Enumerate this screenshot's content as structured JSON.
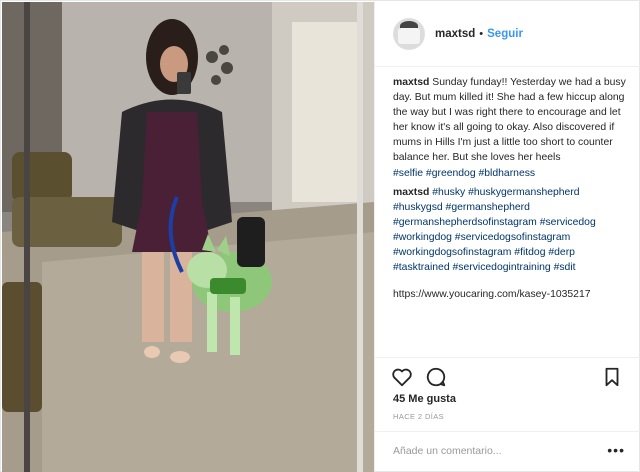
{
  "post": {
    "username": "maxtsd",
    "follow_label": "Seguir",
    "separator": "•",
    "caption": {
      "username": "maxtsd",
      "text": "Sunday funday!! Yesterday we had a busy day. But mum killed it! She had a few hiccup along the way but I was right there to encourage and let her know it's all going to okay. Also discovered if mums in Hills I'm just a little too short to counter balance her. But she loves her heels",
      "tags": "#selfie #greendog #bldharness"
    },
    "comment": {
      "username": "maxtsd",
      "tags": "#husky #huskygermanshepherd #huskygsd #germanshepherd #germanshepherdsofinstagram #servicedog #workingdog #servicedogsofinstagram #workingdogsofinstagram #fitdog #derp #tasktrained #servicedogintraining #sdit"
    },
    "link": "https://www.youcaring.com/kasey-1035217",
    "likes": "45 Me gusta",
    "time": "HACE 2 DÍAS",
    "add_comment_placeholder": "Añade un comentario...",
    "more_label": "•••"
  },
  "icons": {
    "like": "heart-icon",
    "comment": "comment-bubble-icon",
    "save": "bookmark-icon",
    "options": "more-options-icon"
  },
  "colors": {
    "link_blue": "#3897f0",
    "hashtag": "#003569",
    "muted": "#999999",
    "text": "#262626"
  }
}
